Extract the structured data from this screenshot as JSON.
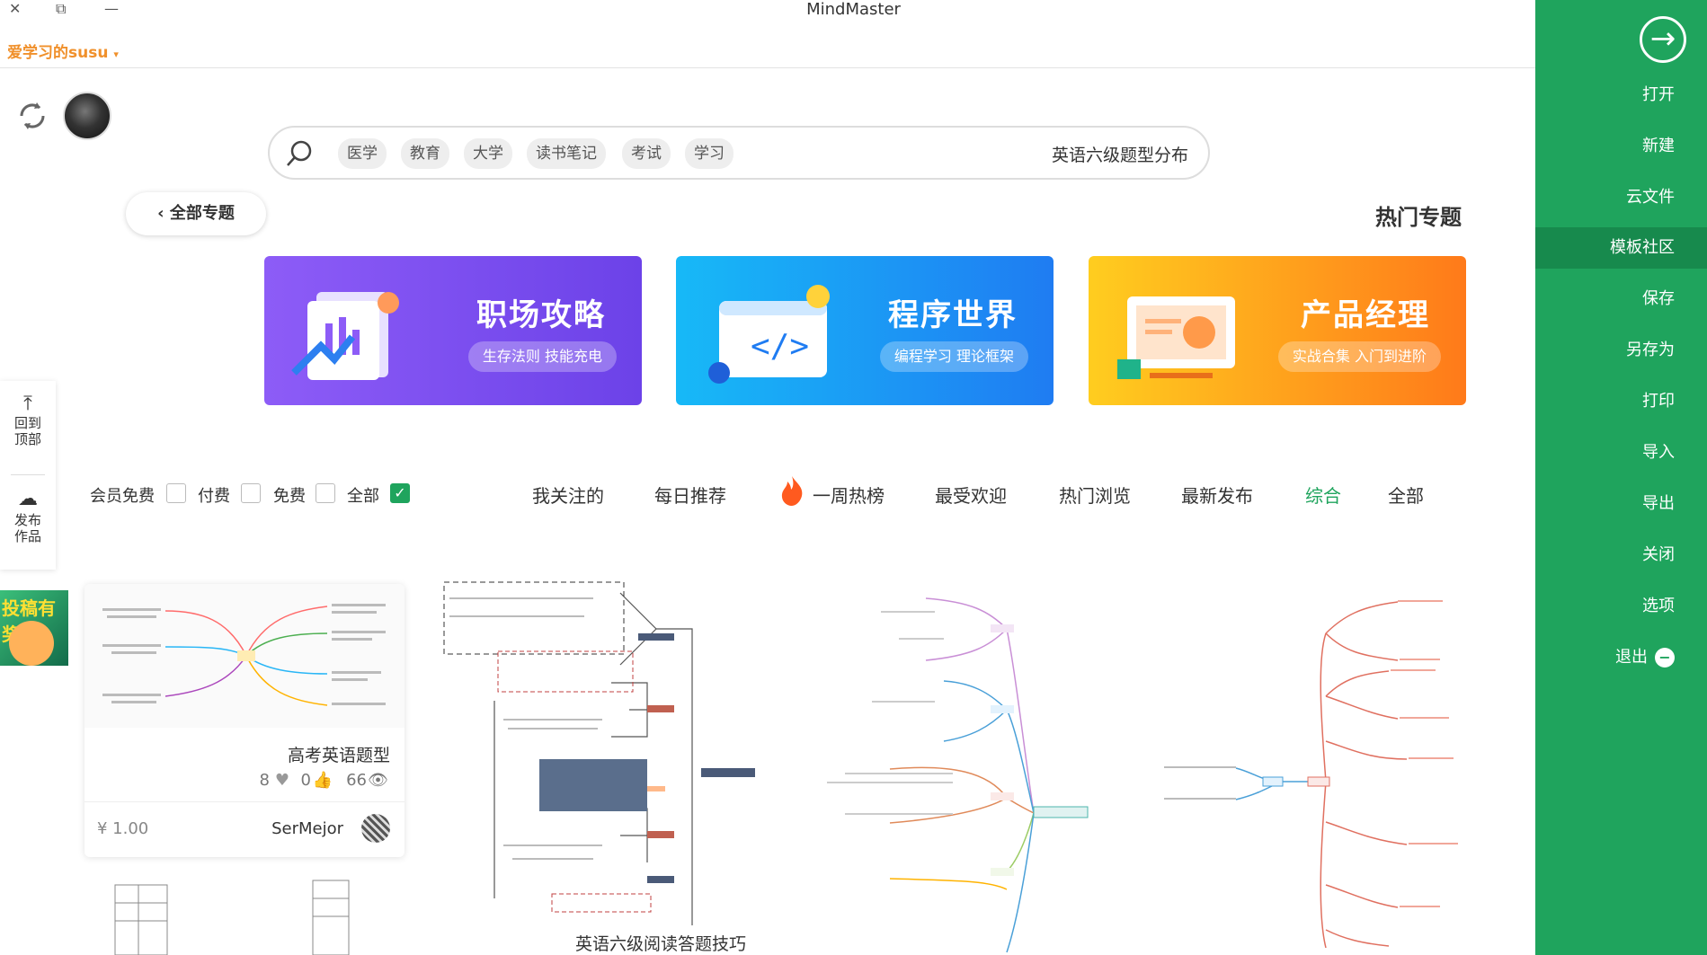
{
  "window": {
    "title": "MindMaster",
    "close_icon": "close-icon",
    "restore_icon": "restore-icon",
    "minimize_icon": "minimize-icon"
  },
  "user": {
    "name": "爱学习的susu"
  },
  "search": {
    "query": "英语六级题型分布",
    "chips": [
      "学习",
      "考试",
      "读书笔记",
      "大学",
      "教育",
      "医学"
    ]
  },
  "topics": {
    "all_label": "全部专题",
    "hot_title": "热门专题"
  },
  "banners": [
    {
      "title": "产品经理",
      "subtitle": "实战合集 入门到进阶",
      "colors": [
        "#ffcf1f",
        "#ff7a1a"
      ]
    },
    {
      "title": "程序世界",
      "subtitle": "编程学习 理论框架",
      "colors": [
        "#19b8f6",
        "#1f7bf2"
      ]
    },
    {
      "title": "职场攻略",
      "subtitle": "生存法则 技能充电",
      "colors": [
        "#8b5cf6",
        "#6b3fe6"
      ]
    }
  ],
  "tabs": [
    "全部",
    "综合",
    "最新发布",
    "热门浏览",
    "最受欢迎",
    "一周热榜",
    "每日推荐",
    "我关注的"
  ],
  "active_tab": "综合",
  "filters": [
    {
      "label": "全部",
      "checked": true
    },
    {
      "label": "免费",
      "checked": false
    },
    {
      "label": "付费",
      "checked": false
    },
    {
      "label": "会员免费",
      "checked": false
    }
  ],
  "float_panel": {
    "top_label": "回到顶部",
    "publish_label": "发布作品"
  },
  "promo": {
    "text": "投稿有奖"
  },
  "sidebar": {
    "items": [
      "打开",
      "新建",
      "云文件",
      "模板社区",
      "保存",
      "另存为",
      "打印",
      "导入",
      "导出",
      "关闭",
      "选项",
      "退出"
    ],
    "active": "模板社区"
  },
  "cards": [
    {
      "title": "高考英语题型",
      "views": "66",
      "likes": "0",
      "favorites": "8",
      "author": "SerMejor",
      "price": "¥ 1.00"
    }
  ],
  "map_caption": "英语六级阅读答题技巧",
  "accent": "#1fa45d"
}
